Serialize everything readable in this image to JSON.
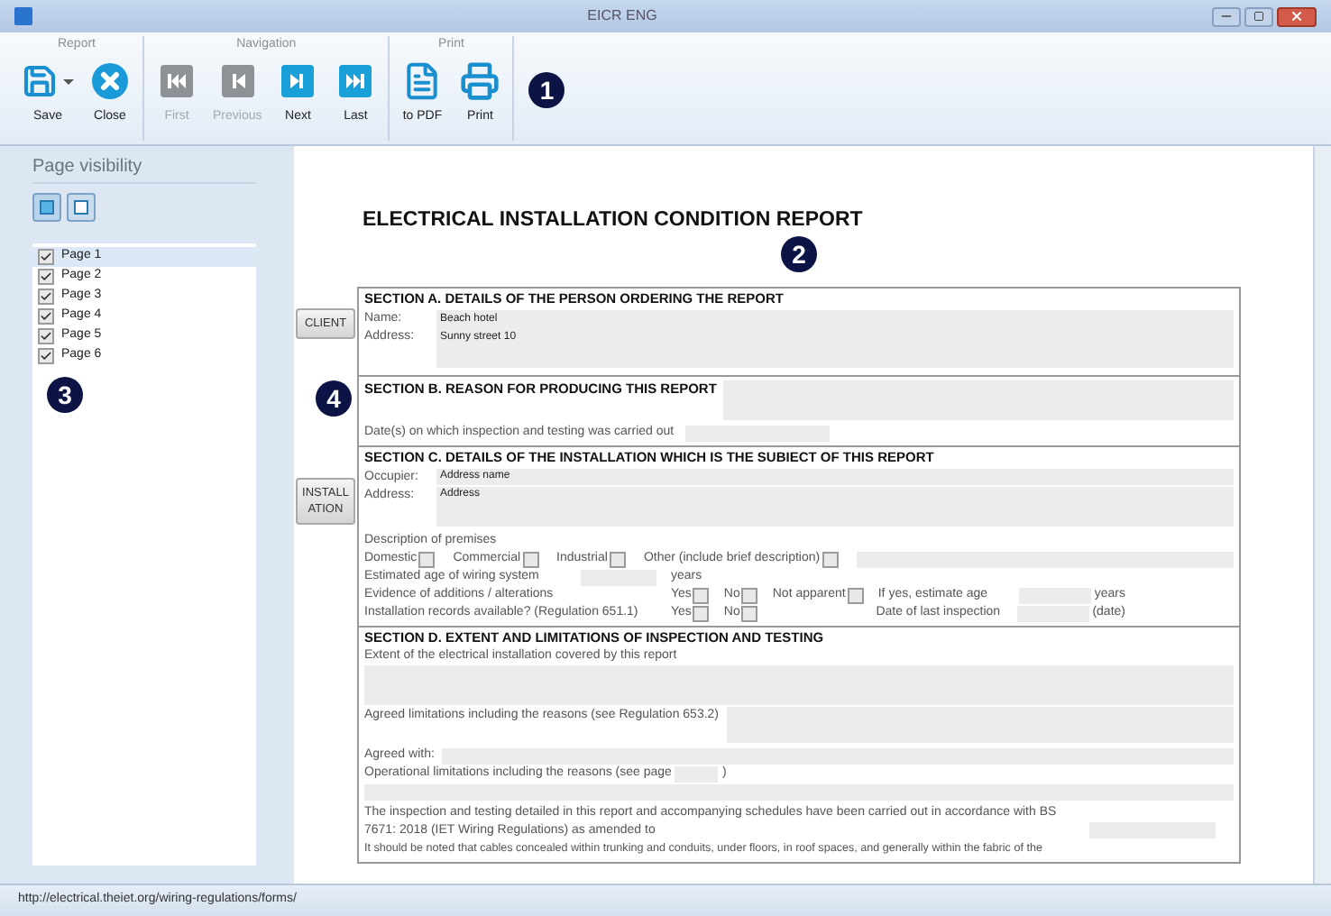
{
  "window": {
    "title": "EICR ENG"
  },
  "ribbon": {
    "groups": [
      {
        "label": "Report",
        "buttons": [
          {
            "label": "Save",
            "kind": "save",
            "disabled": false,
            "dropdown": true
          },
          {
            "label": "Close",
            "kind": "close",
            "disabled": false,
            "dropdown": false
          }
        ]
      },
      {
        "label": "Navigation",
        "buttons": [
          {
            "label": "First",
            "kind": "first",
            "disabled": true,
            "dropdown": false
          },
          {
            "label": "Previous",
            "kind": "previous",
            "disabled": true,
            "dropdown": false
          },
          {
            "label": "Next",
            "kind": "next",
            "disabled": false,
            "dropdown": false
          },
          {
            "label": "Last",
            "kind": "last",
            "disabled": false,
            "dropdown": false
          }
        ]
      },
      {
        "label": "Print",
        "buttons": [
          {
            "label": "to PDF",
            "kind": "pdf",
            "disabled": false,
            "dropdown": false
          },
          {
            "label": "Print",
            "kind": "print",
            "disabled": false,
            "dropdown": false
          }
        ]
      }
    ],
    "callout": "1"
  },
  "sidebar": {
    "title": "Page visibility",
    "pages": [
      {
        "label": "Page 1",
        "checked": true,
        "selected": true
      },
      {
        "label": "Page 2",
        "checked": true,
        "selected": false
      },
      {
        "label": "Page 3",
        "checked": true,
        "selected": false
      },
      {
        "label": "Page 4",
        "checked": true,
        "selected": false
      },
      {
        "label": "Page 5",
        "checked": true,
        "selected": false
      },
      {
        "label": "Page 6",
        "checked": true,
        "selected": false
      }
    ],
    "callout": "3"
  },
  "document": {
    "title": "ELECTRICAL INSTALLATION CONDITION REPORT",
    "callout": "2",
    "section_a": {
      "heading": "SECTION A. DETAILS OF THE PERSON ORDERING THE REPORT",
      "side_button": [
        "CLIENT"
      ],
      "fields": [
        {
          "label": "Name:",
          "value": "Beach hotel"
        },
        {
          "label": "Address:",
          "value": "Sunny street 10"
        }
      ]
    },
    "section_b": {
      "heading": "SECTION B. REASON FOR PRODUCING THIS REPORT",
      "callout": "4",
      "date_label": "Date(s) on which inspection and testing was carried out"
    },
    "section_c": {
      "heading": "SECTION C. DETAILS OF THE INSTALLATION WHICH IS THE SUBIECT OF THIS REPORT",
      "side_button": [
        "INSTALL",
        "ATION"
      ],
      "fields": [
        {
          "label": "Occupier:",
          "value": "Address name"
        },
        {
          "label": "Address:",
          "value": "Address"
        }
      ],
      "premises_label": "Description of premises",
      "premises": [
        {
          "label": "Domestic",
          "checked": false
        },
        {
          "label": "Commercial",
          "checked": false
        },
        {
          "label": "Industrial",
          "checked": false
        },
        {
          "label": "Other (include brief description)",
          "checked": false
        }
      ],
      "age_label": "Estimated age of wiring system",
      "age_unit": "years",
      "evidence_label": "Evidence of additions / alterations",
      "evidence": [
        {
          "label": "Yes",
          "checked": false
        },
        {
          "label": "No",
          "checked": false
        },
        {
          "label": "Not apparent",
          "checked": false
        }
      ],
      "estimate_label": "If yes, estimate age",
      "estimate_unit": "years",
      "records_label": "Installation records available? (Regulation 651.1)",
      "records": [
        {
          "label": "Yes",
          "checked": false
        },
        {
          "label": "No",
          "checked": false
        }
      ],
      "last_label": "Date of last inspection",
      "last_unit": "(date)"
    },
    "section_d": {
      "heading": "SECTION D. EXTENT AND LIMITATIONS OF INSPECTION AND TESTING",
      "extent_label": "Extent of the electrical installation covered by this report",
      "agreed_label": "Agreed limitations including the reasons (see Regulation 653.2)",
      "agreed_with_label": "Agreed with:",
      "operational_label": "Operational limitations including the reasons (see page",
      "operational_close": ")",
      "statement": "The inspection and testing detailed in this report and accompanying schedules have been carried out in accordance with BS 7671: 2018 (IET Wiring Regulations) as amended to",
      "note": "It should be noted that cables concealed within trunking and conduits, under floors, in roof spaces, and generally within the fabric of the"
    }
  },
  "status_bar": {
    "url": "http://electrical.theiet.org/wiring-regulations/forms/"
  }
}
